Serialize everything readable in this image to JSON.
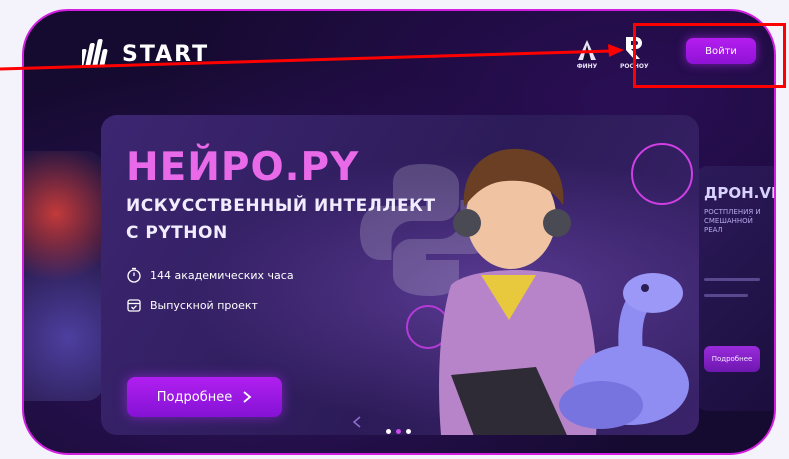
{
  "header": {
    "brand": "START",
    "partners": [
      {
        "name": "ФИНУ",
        "icon": "finu-logo-icon"
      },
      {
        "name": "РОСНОУ",
        "icon": "rosnou-logo-icon"
      }
    ],
    "login_label": "Войти"
  },
  "banner": {
    "title": "НЕЙРО.PY",
    "subtitle_line1": "ИСКУССТВЕННЫЙ ИНТЕЛЛЕКТ",
    "subtitle_line2": "С PYTHON",
    "features": [
      {
        "icon": "stopwatch-icon",
        "text": "144 академических часа"
      },
      {
        "icon": "calendar-check-icon",
        "text": "Выпускной проект"
      }
    ],
    "button_label": "Подробнее",
    "carousel": {
      "slides": 3,
      "active": 2
    }
  },
  "side_card_right": {
    "title": "ДРОН.VR",
    "subtitle": "РОСТПЛЕНИЯ И СМЕШАННОЙ РЕАЛ",
    "button_label": "Подробнее"
  },
  "colors": {
    "accent": "#b11ff0",
    "title": "#e96ae8",
    "frame_border": "#d21ee0",
    "annotation": "#ff0000"
  }
}
